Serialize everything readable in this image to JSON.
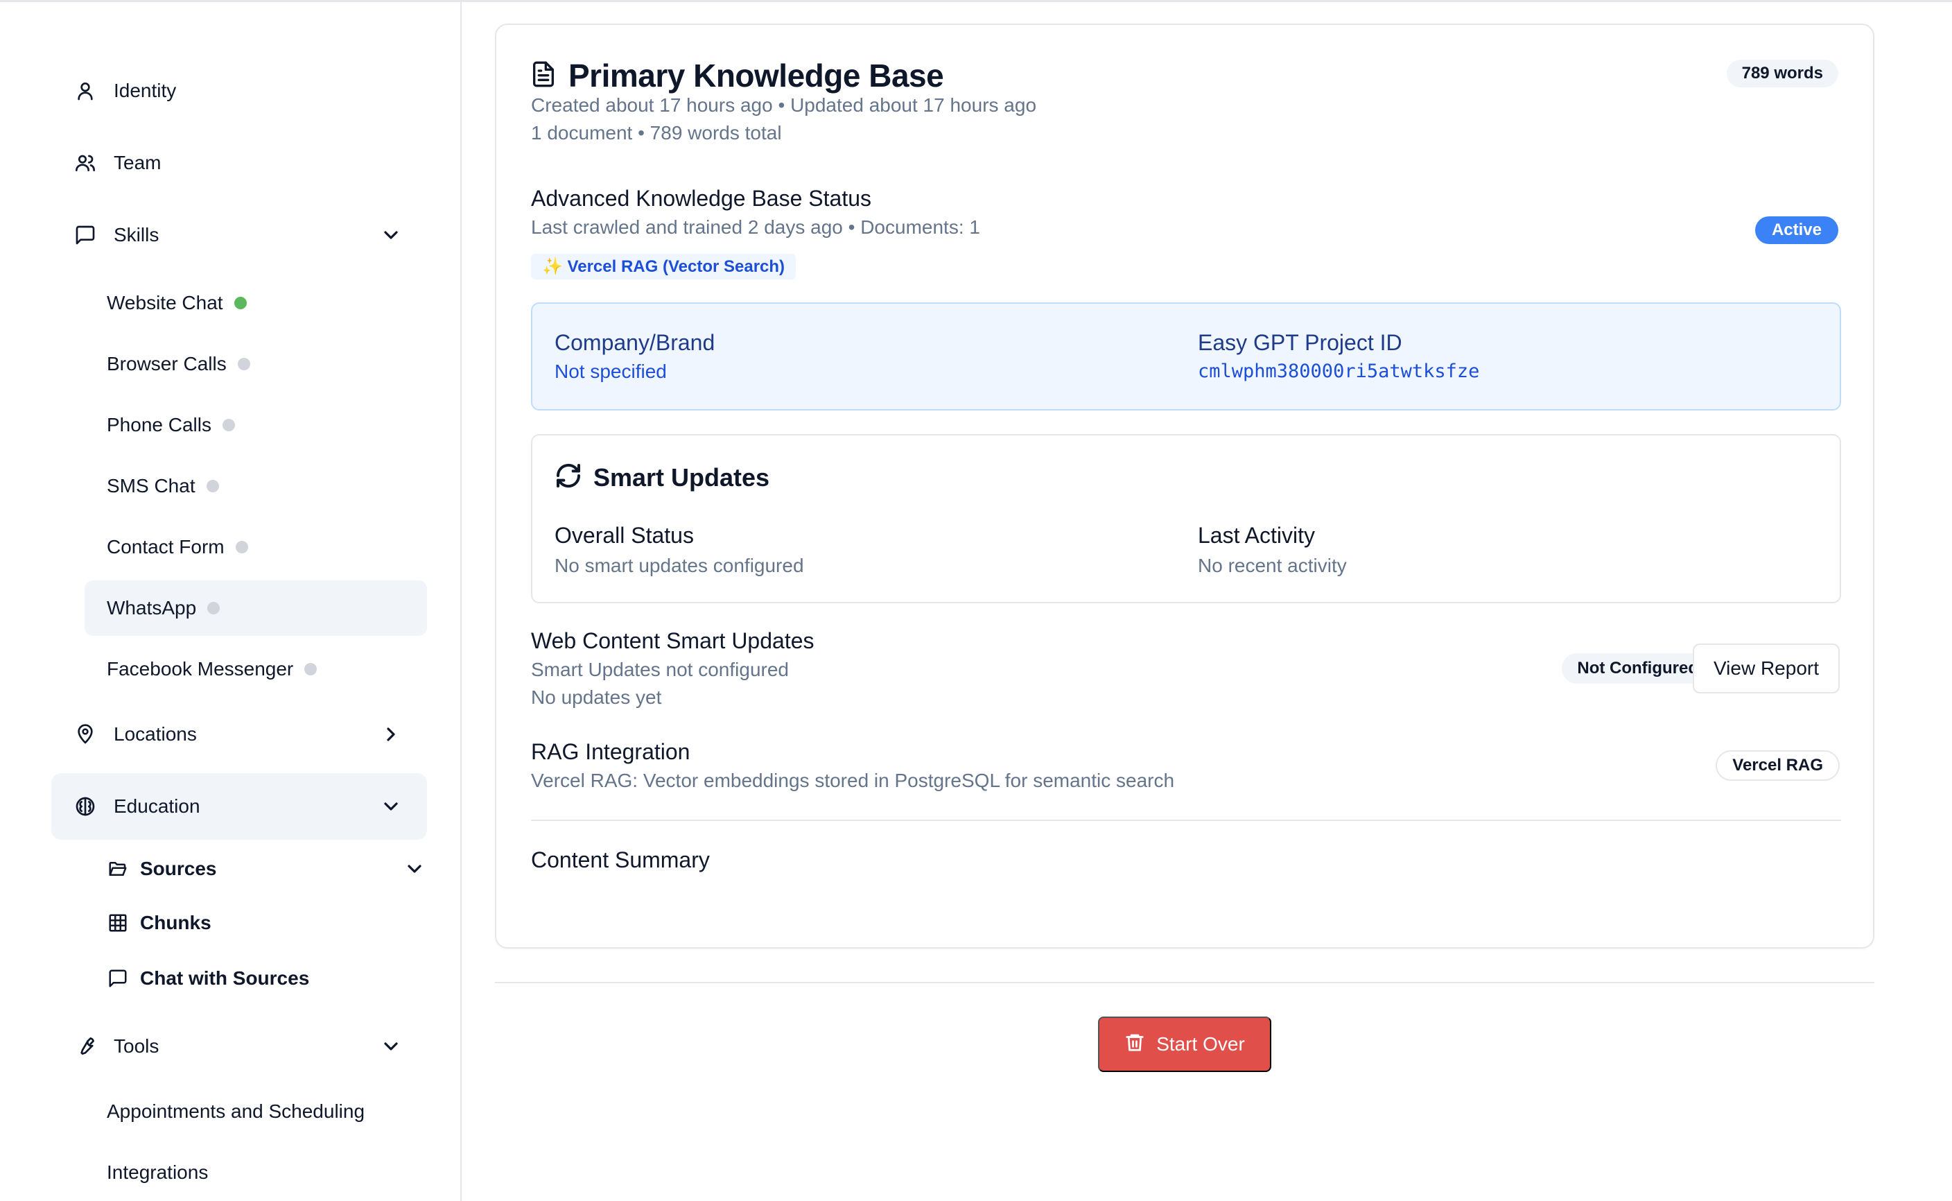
{
  "sidebar": {
    "identity": "Identity",
    "team": "Team",
    "skills": "Skills",
    "skill_items": [
      {
        "label": "Website Chat",
        "status": "active"
      },
      {
        "label": "Browser Calls",
        "status": "inactive"
      },
      {
        "label": "Phone Calls",
        "status": "inactive"
      },
      {
        "label": "SMS Chat",
        "status": "inactive"
      },
      {
        "label": "Contact Form",
        "status": "inactive"
      },
      {
        "label": "WhatsApp",
        "status": "inactive"
      },
      {
        "label": "Facebook Messenger",
        "status": "inactive"
      }
    ],
    "locations": "Locations",
    "education": "Education",
    "education_items": {
      "sources": "Sources",
      "chunks": "Chunks",
      "chat_with_sources": "Chat with Sources"
    },
    "tools": "Tools",
    "tool_items": [
      "Appointments and Scheduling",
      "Integrations"
    ]
  },
  "kb": {
    "title": "Primary Knowledge Base",
    "words_badge": "789 words",
    "meta_created": "Created about 17 hours ago • Updated about 17 hours ago",
    "meta_docs": "1 document • 789 words total"
  },
  "advanced": {
    "title": "Advanced Knowledge Base Status",
    "subtitle": "Last crawled and trained 2 days ago • Documents: 1",
    "rag_chip": "✨ Vercel RAG (Vector Search)",
    "status_badge": "Active"
  },
  "info": {
    "company_label": "Company/Brand",
    "company_value": "Not specified",
    "project_label": "Easy GPT Project ID",
    "project_value": "cmlwphm380000ri5atwtksfze"
  },
  "smart_updates": {
    "title": "Smart Updates",
    "overall_label": "Overall Status",
    "overall_value": "No smart updates configured",
    "activity_label": "Last Activity",
    "activity_value": "No recent activity"
  },
  "web_content": {
    "title": "Web Content Smart Updates",
    "line1": "Smart Updates not configured",
    "line2": "No updates yet",
    "badge": "Not Configured",
    "button": "View Report"
  },
  "rag": {
    "title": "RAG Integration",
    "description": "Vercel RAG: Vector embeddings stored in PostgreSQL for semantic search",
    "badge": "Vercel RAG"
  },
  "content_summary": {
    "title": "Content Summary"
  },
  "actions": {
    "start_over": "Start Over"
  },
  "colors": {
    "accent_blue": "#3b82f6",
    "danger_red": "#e04f4a",
    "status_green": "#5cb85c",
    "status_gray": "#d1d5db"
  }
}
